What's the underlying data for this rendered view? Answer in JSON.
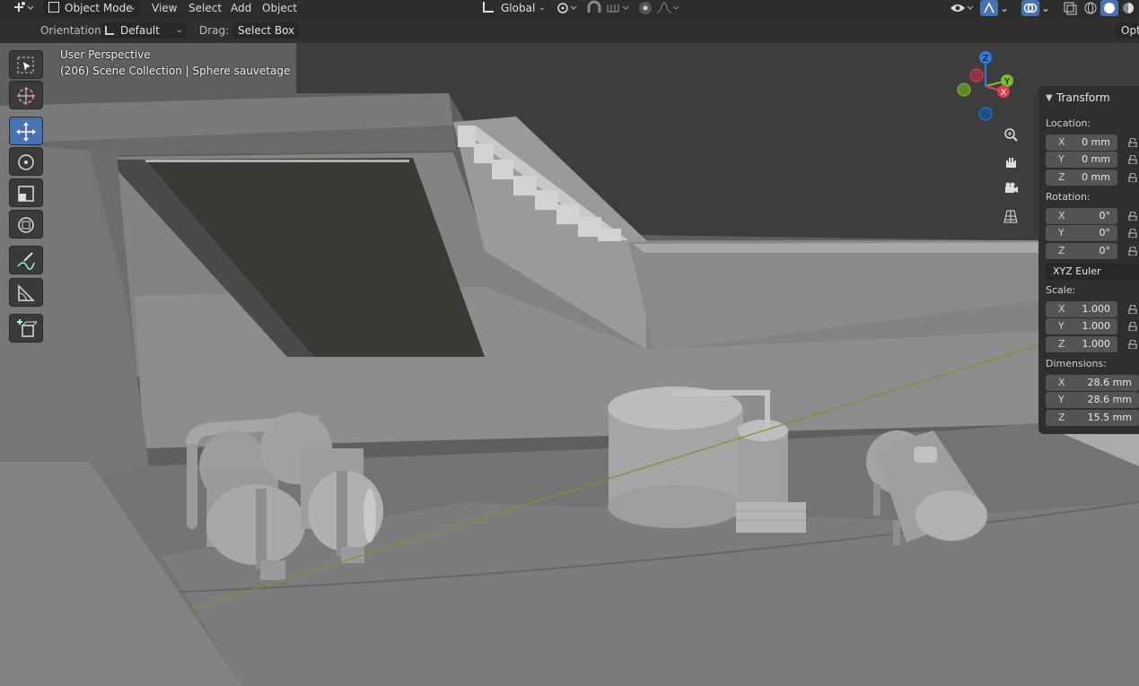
{
  "header": {
    "mode": "Object Mode",
    "menus": [
      "View",
      "Select",
      "Add",
      "Object"
    ],
    "transform_orientation": "Global"
  },
  "tool_settings": {
    "orientation_label": "Orientation:",
    "orientation_value": "Default",
    "drag_label": "Drag:",
    "drag_value": "Select Box",
    "options_label": "Opti"
  },
  "viewport": {
    "perspective": "User Perspective",
    "collection_info": "(206) Scene Collection | Sphere sauvetage"
  },
  "gizmo": {
    "x": "X",
    "y": "Y",
    "z": "Z",
    "x_color": "#e23e52",
    "y_color": "#7bbd2a",
    "z_color": "#2d7dd8"
  },
  "transform_panel": {
    "title": "Transform",
    "location_label": "Location:",
    "location": [
      {
        "axis": "X",
        "value": "0 mm"
      },
      {
        "axis": "Y",
        "value": "0 mm"
      },
      {
        "axis": "Z",
        "value": "0 mm"
      }
    ],
    "rotation_label": "Rotation:",
    "rotation": [
      {
        "axis": "X",
        "value": "0°"
      },
      {
        "axis": "Y",
        "value": "0°"
      },
      {
        "axis": "Z",
        "value": "0°"
      }
    ],
    "rotation_mode": "XYZ Euler",
    "scale_label": "Scale:",
    "scale": [
      {
        "axis": "X",
        "value": "1.000"
      },
      {
        "axis": "Y",
        "value": "1.000"
      },
      {
        "axis": "Z",
        "value": "1.000"
      }
    ],
    "dimensions_label": "Dimensions:",
    "dimensions": [
      {
        "axis": "X",
        "value": "28.6 mm"
      },
      {
        "axis": "Y",
        "value": "28.6 mm"
      },
      {
        "axis": "Z",
        "value": "15.5 mm"
      }
    ]
  },
  "toolbar_tools": [
    "select-box-icon",
    "cursor-icon",
    "move-icon",
    "rotate-icon",
    "scale-icon",
    "transform-icon",
    "annotate-icon",
    "measure-icon",
    "add-cube-icon"
  ],
  "accent_color": "#4772b3"
}
